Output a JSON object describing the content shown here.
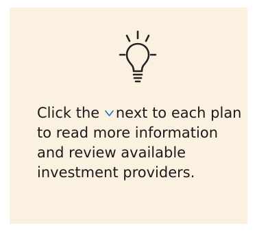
{
  "tip": {
    "icon": "lightbulb-icon",
    "inline_icon": "chevron-down-icon",
    "text_before": "Click the",
    "text_after": "next to each plan to read more information and review available investment providers.",
    "accent_color": "#1a73c8",
    "background_color": "#fbf1e1"
  }
}
